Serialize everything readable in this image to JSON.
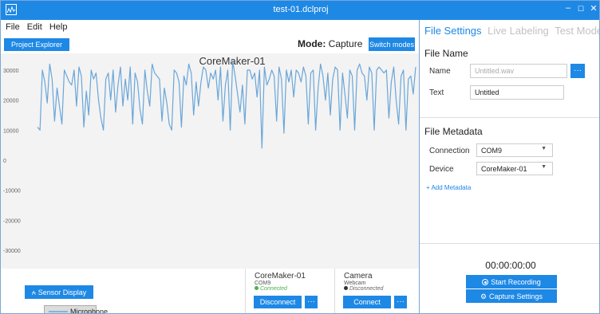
{
  "window": {
    "title": "test-01.dclproj",
    "min": "–",
    "max": "☐",
    "close": "✕"
  },
  "menu": [
    "File",
    "Edit",
    "Help"
  ],
  "toolbar": {
    "project_explorer": "Project Explorer",
    "mode_label": "Mode:",
    "mode_value": "Capture",
    "switch_modes": "Switch modes"
  },
  "chart_data": {
    "type": "line",
    "title": "CoreMaker-01",
    "ylim": [
      -35000,
      35000
    ],
    "yticks": [
      30000,
      20000,
      10000,
      0,
      -10000,
      -20000,
      -30000
    ],
    "grid": false,
    "legend_position": "bottom-left",
    "series": [
      {
        "name": "Microphone",
        "color": "#6aa6d8",
        "values": [
          11000,
          10000,
          30000,
          26000,
          19000,
          32000,
          27000,
          13000,
          24000,
          18000,
          12000,
          30000,
          28000,
          26000,
          25000,
          30000,
          18000,
          31000,
          28000,
          11000,
          23000,
          15000,
          30000,
          27000,
          29000,
          20000,
          14000,
          10000,
          27000,
          29000,
          20000,
          30000,
          16000,
          25000,
          31000,
          18000,
          27000,
          20000,
          31000,
          12000,
          29000,
          26000,
          17000,
          12000,
          30000,
          23000,
          18000,
          32000,
          29000,
          28000,
          27000,
          13000,
          24000,
          19000,
          12000,
          10000,
          30000,
          29000,
          26000,
          11000,
          28000,
          25000,
          32000,
          29000,
          15000,
          26000,
          18000,
          26000,
          31000,
          30000,
          24000,
          29000,
          27000,
          30000,
          20000,
          31000,
          13000,
          25000,
          30000,
          10000,
          33000,
          28000,
          22000,
          16000,
          25000,
          12000,
          30000,
          30000,
          27000,
          29000,
          21000,
          30000,
          4000,
          31000,
          25000,
          27000,
          30000,
          28000,
          13000,
          31000,
          27000,
          9000,
          30000,
          26000,
          30000,
          21000,
          30000,
          29000,
          26000,
          31000,
          28000,
          12000,
          29000,
          30000,
          10000,
          24000,
          32000,
          28000,
          20000,
          29000,
          15000,
          27000,
          31000,
          30000,
          10000,
          29000,
          22000,
          14000,
          30000,
          28000,
          10000,
          30000,
          32000,
          29000,
          28000,
          20000,
          31000,
          29000,
          10000,
          30000,
          31000,
          30000,
          29000,
          30000,
          14000,
          26000,
          31000,
          20000,
          12000,
          28000,
          30000,
          10000,
          27000,
          28000,
          22000,
          31000
        ]
      }
    ]
  },
  "legend": {
    "label": "Microphone"
  },
  "sensor_display": "Sensor Display",
  "devices": [
    {
      "name": "CoreMaker-01",
      "port": "COM9",
      "status": "Connected",
      "status_color": "#4caf50",
      "action": "Disconnect",
      "more": "···"
    },
    {
      "name": "Camera",
      "port": "Webcam",
      "status": "Disconnected",
      "status_color": "#333333",
      "action": "Connect",
      "more": "···"
    }
  ],
  "right": {
    "tabs": [
      "File Settings",
      "Live Labeling",
      "Test Model"
    ],
    "file_name_section": "File Name",
    "name_label": "Name",
    "name_placeholder": "Untitled.wav",
    "browse_btn": "···",
    "text_label": "Text",
    "text_value": "Untitled",
    "metadata_section": "File Metadata",
    "connection_label": "Connection",
    "connection_value": "COM9",
    "device_label": "Device",
    "device_value": "CoreMaker-01",
    "add_metadata": "+ Add Metadata",
    "timer": "00:00:00:00",
    "start_recording": "Start Recording",
    "capture_settings": "Capture Settings"
  },
  "colors": {
    "accent": "#1e88e5",
    "titlebar": "#1e88e5",
    "line": "#6aa6d8"
  }
}
